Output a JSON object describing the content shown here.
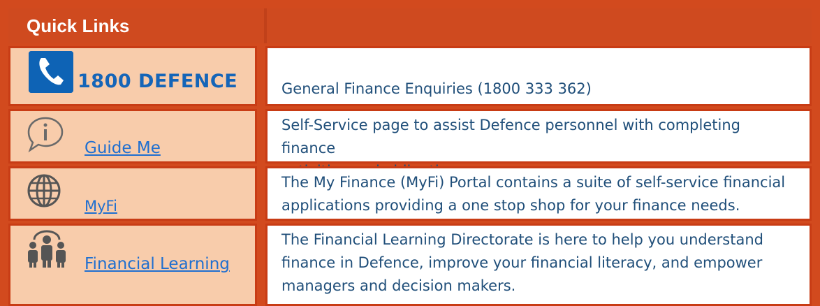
{
  "header": {
    "title": "Quick Links"
  },
  "rows": [
    {
      "name": "1800 DEFENCE",
      "description": "General Finance Enquiries (1800 333 362)",
      "icon": "phone-icon"
    },
    {
      "name": "Guide Me",
      "description_lines": [
        "Self-Service page to assist Defence personnel with completing finance",
        "activities and obligations"
      ],
      "icon": "info-speech-bubble-icon"
    },
    {
      "name": "MyFi",
      "description_lines": [
        "The My Finance (MyFi) Portal contains a suite of self-service financial",
        "applications providing a one stop shop for your finance needs."
      ],
      "icon": "globe-icon"
    },
    {
      "name": "Financial Learning",
      "description_lines": [
        "The Financial Learning Directorate is here to help you understand",
        "finance in Defence, improve your financial literacy, and empower",
        "managers and decision makers."
      ],
      "icon": "people-group-icon"
    }
  ],
  "colors": {
    "accent": "#d24a1e",
    "cell_fill": "#f8ccab",
    "link": "#1f6fd0",
    "text": "#1f4e79",
    "phone": "#0e63b5"
  }
}
